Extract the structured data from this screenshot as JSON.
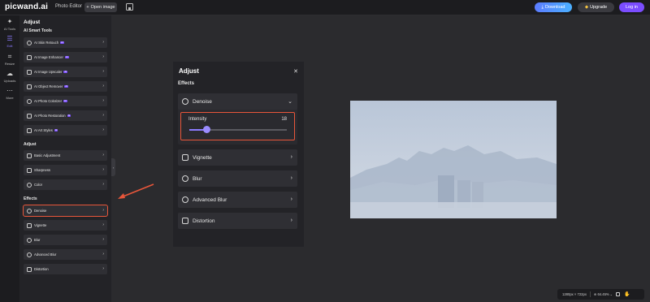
{
  "topbar": {
    "logo": "picwand.ai",
    "photo_editor": "Photo Editor",
    "open_image": "Open image",
    "download": "Download",
    "upgrade": "Upgrade",
    "login": "Log in"
  },
  "rail": [
    {
      "label": "AI Tools",
      "icon": "sparkle-icon"
    },
    {
      "label": "Edit",
      "icon": "sliders-icon"
    },
    {
      "label": "Resize",
      "icon": "crop-icon"
    },
    {
      "label": "Uploads",
      "icon": "cloud-upload-icon"
    },
    {
      "label": "More",
      "icon": "more-icon"
    }
  ],
  "side": {
    "title": "Adjust",
    "ai_section": "AI Smart Tools",
    "ai_items": [
      {
        "label": "AI Skin Retouch",
        "badge": "AI"
      },
      {
        "label": "AI Image Enhancer",
        "badge": "AI"
      },
      {
        "label": "AI Image Upscaler",
        "badge": "AI"
      },
      {
        "label": "AI Object Remover",
        "badge": "AI"
      },
      {
        "label": "AI Photo Colorizer",
        "badge": "AI"
      },
      {
        "label": "AI Photo Restoration",
        "badge": "AI"
      },
      {
        "label": "AI Art Styles",
        "badge": "AI"
      }
    ],
    "adjust_section": "Adjust",
    "adjust_items": [
      "Basic Adjustment",
      "Sharpness",
      "Color"
    ],
    "effects_section": "Effects",
    "effects_items": [
      "Denoise",
      "Vignette",
      "Blur",
      "Advanced Blur",
      "Distortion"
    ]
  },
  "adjust_panel": {
    "title": "Adjust",
    "section": "Effects",
    "denoise": "Denoise",
    "intensity_label": "Intensity",
    "intensity_value": "18",
    "intensity_fraction": 0.18,
    "items": [
      "Vignette",
      "Blur",
      "Advanced Blur",
      "Distortion"
    ]
  },
  "status": {
    "dimensions": "1280px × 722px",
    "zoom": "64.45%"
  },
  "colors": {
    "accent": "#7b4dff",
    "highlight": "#e8563a"
  }
}
